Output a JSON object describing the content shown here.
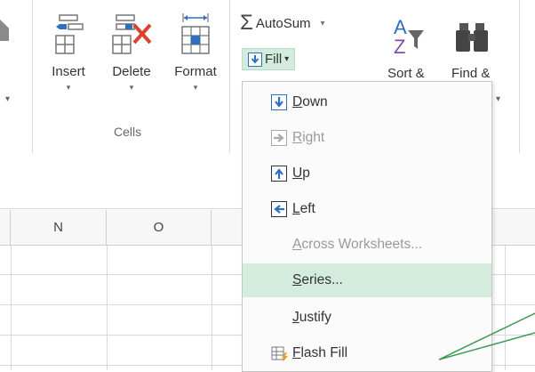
{
  "ribbon": {
    "cells_group": {
      "label": "Cells",
      "insert": {
        "label": "Insert",
        "arrow": "▾"
      },
      "delete": {
        "label": "Delete",
        "arrow": "▾"
      },
      "format": {
        "label": "Format",
        "arrow": "▾"
      }
    },
    "editing_group": {
      "autosum": {
        "label": "AutoSum",
        "symbol": "Σ",
        "arrow": "▾"
      },
      "fill": {
        "label": "Fill",
        "arrow": "▾"
      },
      "sort_filter": {
        "label_partial": "Sort &"
      },
      "find_select": {
        "label_partial": "Find &"
      }
    },
    "left_arrow": "▾",
    "right_arrow": "▾"
  },
  "sheet": {
    "columns": [
      "N",
      "O"
    ]
  },
  "fill_menu": {
    "items": [
      {
        "label": "Down",
        "accel": "D",
        "rest": "own",
        "icon": "fill-down-icon",
        "disabled": false,
        "highlighted": false
      },
      {
        "label": "Right",
        "accel": "R",
        "rest": "ight",
        "icon": "fill-right-icon",
        "disabled": true,
        "highlighted": false
      },
      {
        "label": "Up",
        "accel": "U",
        "rest": "p",
        "icon": "fill-up-icon",
        "disabled": false,
        "highlighted": false
      },
      {
        "label": "Left",
        "accel": "L",
        "rest": "eft",
        "icon": "fill-left-icon",
        "disabled": false,
        "highlighted": false
      },
      {
        "label": "Across Worksheets...",
        "accel": "A",
        "rest": "cross Worksheets...",
        "icon": "",
        "disabled": true,
        "highlighted": false
      },
      {
        "label": "Series...",
        "accel": "S",
        "rest": "eries...",
        "icon": "",
        "disabled": false,
        "highlighted": true
      },
      {
        "label": "Justify",
        "accel": "J",
        "rest": "ustify",
        "icon": "",
        "disabled": false,
        "highlighted": false
      },
      {
        "label": "Flash Fill",
        "accel": "F",
        "rest": "lash Fill",
        "icon": "flash-fill-icon",
        "disabled": false,
        "highlighted": false
      }
    ]
  },
  "colors": {
    "highlight": "#d3ecdd",
    "accent_blue": "#2f6fbf",
    "callout_green": "#3c9a54"
  }
}
